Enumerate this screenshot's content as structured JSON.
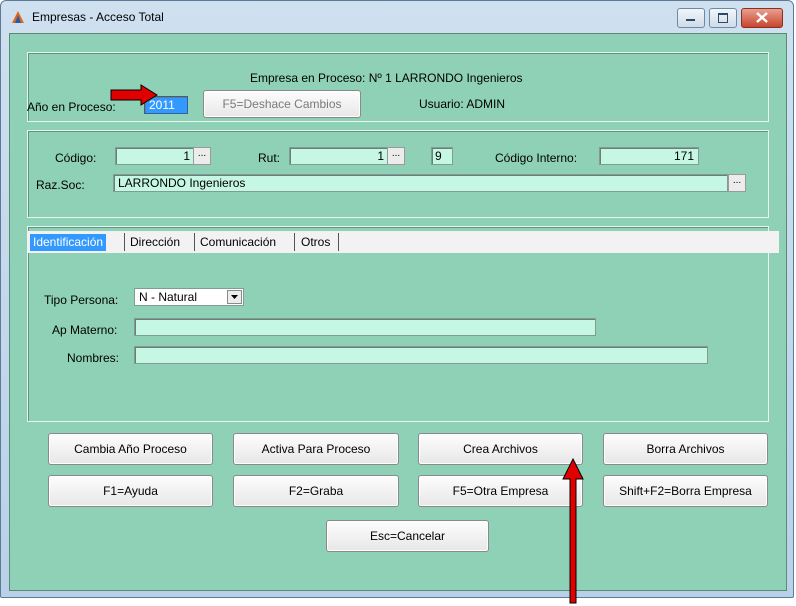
{
  "window": {
    "title": "Empresas - Acceso Total"
  },
  "header": {
    "empresa_en_proceso": "Empresa en Proceso: Nº 1 LARRONDO Ingenieros",
    "anio_label": "Año en Proceso:",
    "anio_value": "2011",
    "deshace_button": "F5=Deshace Cambios",
    "usuario": "Usuario: ADMIN"
  },
  "company": {
    "codigo_label": "Código:",
    "codigo_value": "1",
    "rut_label": "Rut:",
    "rut_value": "1",
    "dv_value": "9",
    "codigo_interno_label": "Código Interno:",
    "codigo_interno_value": "171",
    "razsoc_label": "Raz.Soc:",
    "razsoc_value": "LARRONDO Ingenieros",
    "ellipsis": "..."
  },
  "tabs": [
    "Identificación",
    "Dirección",
    "Comunicación",
    "Otros"
  ],
  "identificacion": {
    "tipo_persona_label": "Tipo Persona:",
    "tipo_persona_value": "N - Natural",
    "ap_materno_label": "Ap Materno:",
    "ap_materno_value": "",
    "nombres_label": "Nombres:",
    "nombres_value": ""
  },
  "buttons": {
    "cambia_anio": "Cambia Año Proceso",
    "activa_para_proceso": "Activa Para Proceso",
    "crea_archivos": "Crea Archivos",
    "borra_archivos": "Borra Archivos",
    "ayuda": "F1=Ayuda",
    "graba": "F2=Graba",
    "otra_empresa": "F5=Otra Empresa",
    "borra_empresa": "Shift+F2=Borra Empresa",
    "cancelar": "Esc=Cancelar"
  },
  "colors": {
    "panel": "#8fd1b7",
    "field": "#c5f7e4",
    "arrow": "#e00000",
    "tab_active": "#3399ff"
  }
}
